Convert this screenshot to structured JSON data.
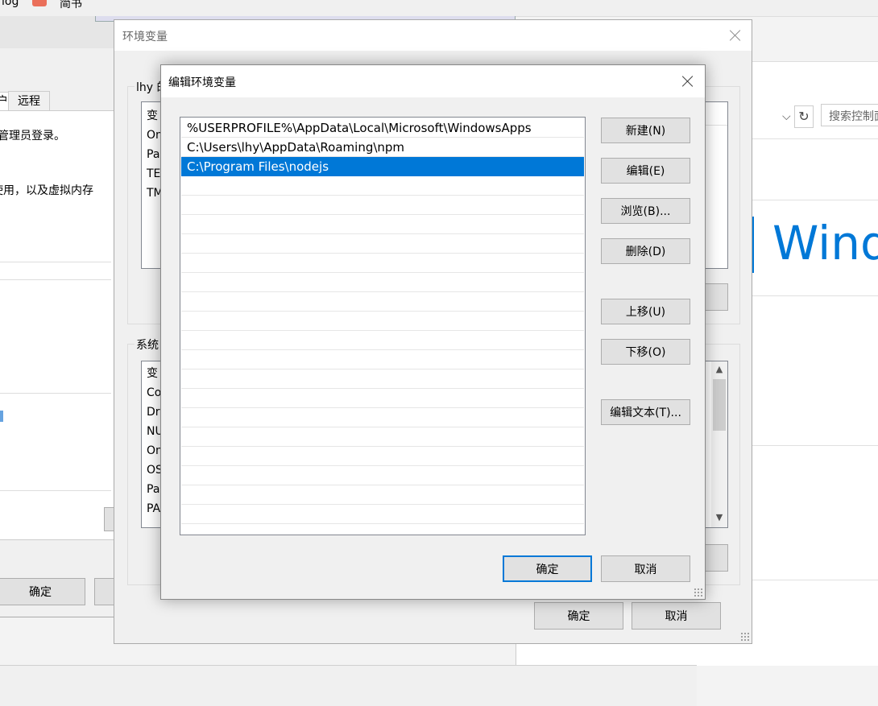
{
  "topbar": {
    "item1": "log",
    "item2": "简书"
  },
  "sysprops": {
    "tab_fragment": "户",
    "tab_remote": "远程",
    "text1": "管理员登录。",
    "text2": "使用，以及虚拟内存",
    "ok_label": "确定"
  },
  "control_panel": {
    "search_placeholder": "搜索控制面",
    "brand_text": "Windows"
  },
  "env_dialog": {
    "title": "环境变量",
    "user_group_fragment": "lhy 的",
    "user_vars_fragments": [
      "变",
      "On",
      "Pa",
      "TE",
      "TM"
    ],
    "system_group_fragment": "系统",
    "system_vars_fragments": [
      "变",
      "Co",
      "Dr",
      "NU",
      "On",
      "OS",
      "Pa",
      "PA"
    ],
    "ok_label": "确定",
    "cancel_label": "取消"
  },
  "edit_dialog": {
    "title": "编辑环境变量",
    "paths": [
      "%USERPROFILE%\\AppData\\Local\\Microsoft\\WindowsApps",
      "C:\\Users\\lhy\\AppData\\Roaming\\npm",
      "C:\\Program Files\\nodejs"
    ],
    "selected_index": 2,
    "buttons": {
      "new": "新建(N)",
      "edit": "编辑(E)",
      "browse": "浏览(B)...",
      "delete": "删除(D)",
      "move_up": "上移(U)",
      "move_down": "下移(O)",
      "edit_text": "编辑文本(T)..."
    },
    "ok_label": "确定",
    "cancel_label": "取消"
  },
  "colors": {
    "accent": "#0078d7",
    "button_bg": "#e1e1e1",
    "button_border": "#adadad"
  }
}
